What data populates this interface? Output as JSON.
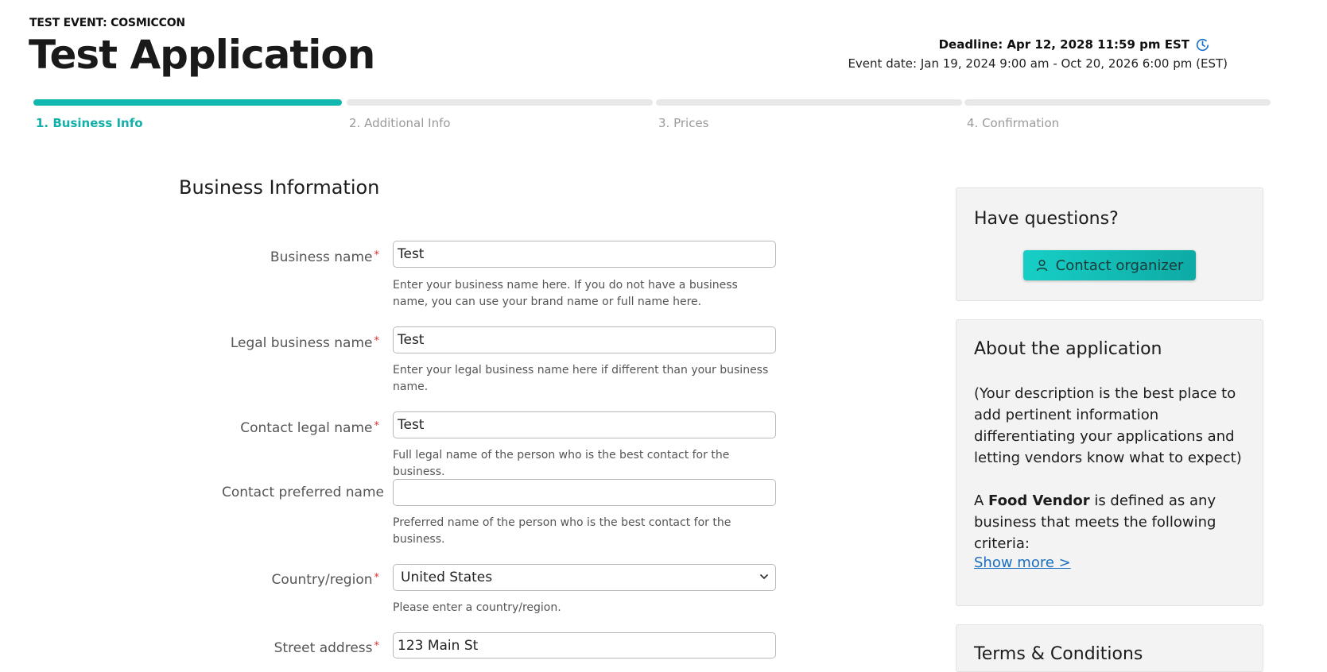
{
  "header": {
    "event_label": "TEST EVENT: COSMICCON",
    "title": "Test Application",
    "deadline": "Deadline: Apr 12, 2028 11:59 pm EST",
    "event_date": "Event date: Jan 19, 2024 9:00 am - Oct 20, 2026 6:00 pm (EST)"
  },
  "steps": [
    {
      "label": "1. Business Info",
      "active": true
    },
    {
      "label": "2. Additional Info",
      "active": false
    },
    {
      "label": "3. Prices",
      "active": false
    },
    {
      "label": "4. Confirmation",
      "active": false
    }
  ],
  "form": {
    "section_title": "Business Information",
    "fields": [
      {
        "label": "Business name",
        "required": true,
        "value": "Test",
        "help": "Enter your business name here. If you do not have a business name, you can use your brand name or full name here."
      },
      {
        "label": "Legal business name",
        "required": true,
        "value": "Test",
        "help": "Enter your legal business name here if different than your business name."
      },
      {
        "label": "Contact legal name",
        "required": true,
        "value": "Test",
        "help": "Full legal name of the person who is the best contact for the business."
      },
      {
        "label": "Contact preferred name",
        "required": false,
        "value": "",
        "help": "Preferred name of the person who is the best contact for the business."
      },
      {
        "label": "Country/region",
        "required": true,
        "value": "United States",
        "help": "Please enter a country/region."
      },
      {
        "label": "Street address",
        "required": true,
        "value": "123 Main St",
        "help": ""
      }
    ],
    "required_mark": "*"
  },
  "sidebar": {
    "questions_title": "Have questions?",
    "contact_button": "Contact organizer",
    "about_title": "About the application",
    "about_description": "(Your description is the best place to add pertinent information differentiating your applications and letting vendors know what to expect)",
    "about_food_prefix": "A ",
    "about_food_bold": "Food Vendor",
    "about_food_suffix": " is defined as any business that meets the following criteria:",
    "show_more": "Show more >",
    "terms_title": "Terms & Conditions"
  },
  "colors": {
    "accent": "#12b8b0",
    "required": "#e23030",
    "link": "#1a6fc0"
  }
}
